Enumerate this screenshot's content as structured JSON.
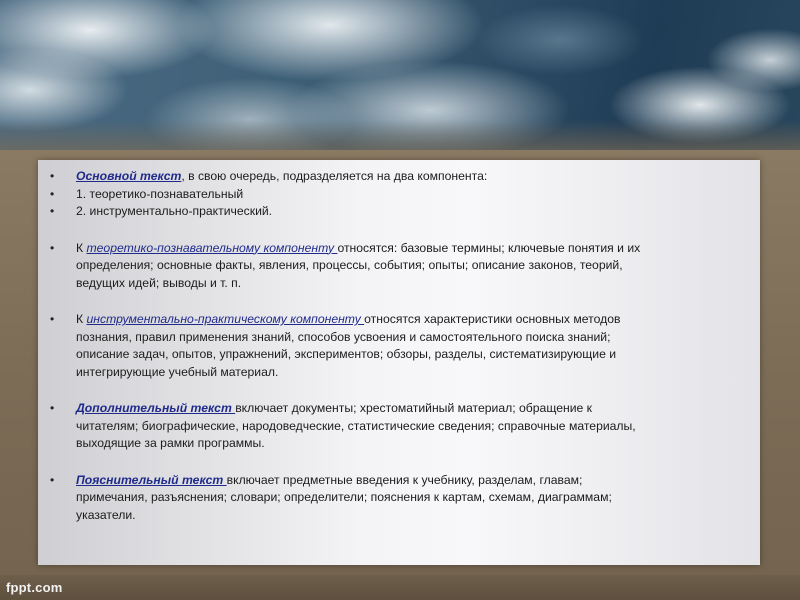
{
  "slide": {
    "lines": {
      "l1_term": "Основной текст",
      "l1_rest": ", в свою очередь, подразделяется на два компонента:",
      "l2": "1. теоретико-познавательный",
      "l3": "2.  инструментально-практический.",
      "p1_pre": "К ",
      "p1_term": "теоретико-познавательному компоненту ",
      "p1_rest": "относятся: базовые термины; ключевые понятия и их",
      "p1_l2": "определения; основные факты, явления, процессы, события; опыты; описание законов, теорий,",
      "p1_l3": "ведущих идей; выводы и т. п.",
      "p2_pre": "К ",
      "p2_term": "инструментально-практическому компоненту ",
      "p2_rest": "относятся характеристики основных методов",
      "p2_l2": "познания, правил применения знаний, способов усвоения и самостоятельного поиска знаний;",
      "p2_l3": "описание задач, опытов, упражнений, экспериментов; обзоры, разделы, систематизирующие и",
      "p2_l4": "интегрирующие учебный материал.",
      "p3_term": "Дополнительный текст ",
      "p3_rest": "включает документы; хрестоматийный материал; обращение к",
      "p3_l2": "читателям; биографические, народоведческие, статистические сведения; справочные материалы,",
      "p3_l3": "выходящие за рамки программы.",
      "p4_term": "Пояснительный текст ",
      "p4_rest": "включает предметные введения к учебнику, разделам, главам;",
      "p4_l2": "примечания, разъяснения; словари; определители; пояснения к картам, схемам, диаграммам;",
      "p4_l3": "указатели."
    },
    "bullet_glyph": "•"
  },
  "footer": {
    "brand": "fppt.com"
  }
}
